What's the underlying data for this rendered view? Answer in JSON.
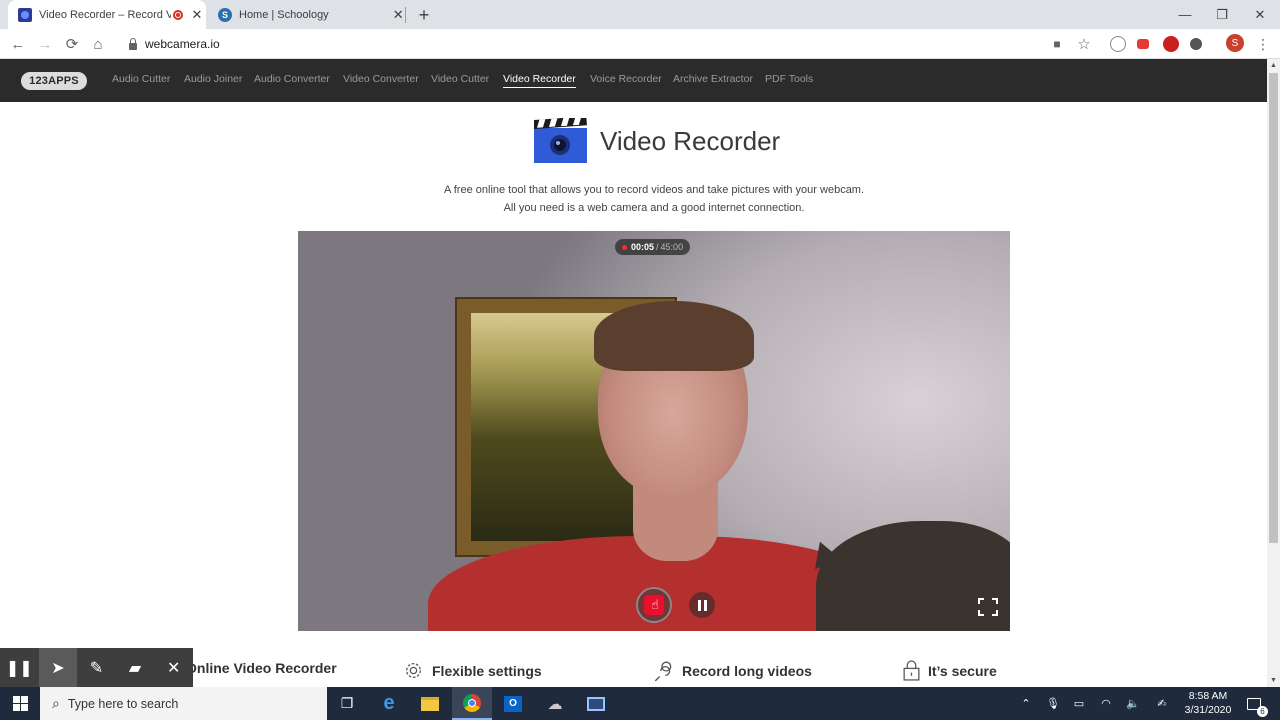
{
  "browser": {
    "tabs": [
      {
        "title": "Video Recorder – Record Vid",
        "active": true
      },
      {
        "title": "Home | Schoology",
        "favicon_letter": "S",
        "active": false
      }
    ],
    "new_tab": "+",
    "window_controls": {
      "minimize": "—",
      "maximize": "❐",
      "close": "✕"
    },
    "url": "webcamera.io",
    "profile_initial": "S",
    "icons": [
      "back-icon",
      "forward-icon",
      "reload-icon",
      "home-icon",
      "lock-icon",
      "camera-icon",
      "star-icon",
      "menu-icon"
    ]
  },
  "site": {
    "logo": "123APPS",
    "nav": [
      "Audio Cutter",
      "Audio Joiner",
      "Audio Converter",
      "Video Converter",
      "Video Cutter",
      "Video Recorder",
      "Voice Recorder",
      "Archive Extractor",
      "PDF Tools"
    ],
    "active_nav": "Video Recorder",
    "title": "Video Recorder",
    "description": "A free online tool that allows you to record videos and take pictures with your webcam. All you need is a web camera and a good internet connection.",
    "recording": {
      "elapsed": "00:05",
      "separator": "/",
      "limit": "45:00"
    },
    "features": [
      {
        "label": "Online Video Recorder",
        "icon": "camera-icon"
      },
      {
        "label": "Flexible settings",
        "icon": "gear-icon"
      },
      {
        "label": "Record long videos",
        "icon": "link-icon"
      },
      {
        "label": "It’s secure",
        "icon": "lock-icon"
      }
    ]
  },
  "taskbar": {
    "search_placeholder": "Type here to search",
    "time": "8:58 AM",
    "date": "3/31/2020",
    "notification_count": "6"
  },
  "colors": {
    "nav_bg": "#2b2b2b",
    "record_red": "#e8102b",
    "taskbar_bg": "#1f2a3c"
  }
}
